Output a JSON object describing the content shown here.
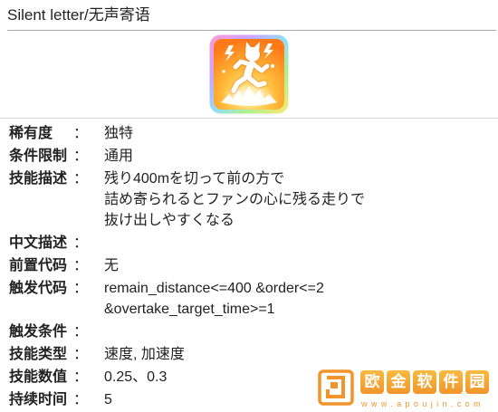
{
  "page": {
    "title": "Silent letter/无声寄语"
  },
  "skill_icon": {
    "icon": "running-figure-icon"
  },
  "separator": "：",
  "rows": [
    {
      "label": "稀有度",
      "lines": [
        "独特"
      ]
    },
    {
      "label": "条件限制",
      "lines": [
        "通用"
      ]
    },
    {
      "label": "技能描述",
      "lines": [
        "残り400mを切って前の方で",
        "詰め寄られるとファンの心に残る走りで",
        "抜け出しやすくなる"
      ]
    },
    {
      "label": "中文描述",
      "lines": []
    },
    {
      "label": "前置代码",
      "lines": [
        "无"
      ]
    },
    {
      "label": "触发代码",
      "lines": [
        "remain_distance<=400 &order<=2",
        "&overtake_target_time>=1"
      ]
    },
    {
      "label": "触发条件",
      "lines": []
    },
    {
      "label": "技能类型",
      "lines": [
        "速度, 加速度"
      ]
    },
    {
      "label": "技能数值",
      "lines": [
        "0.25、0.3"
      ]
    },
    {
      "label": "持续时间",
      "lines": [
        "5"
      ]
    }
  ],
  "watermark": {
    "logo_icon": "apoujin-logo-icon",
    "brand_chars": [
      "欧",
      "金",
      "软",
      "件",
      "园"
    ],
    "url": "www.apoujin.com"
  },
  "colors": {
    "text": "#222222",
    "title_rule": "#a2a9b1",
    "divider": "#d6d6d6",
    "background": "#ffffff",
    "icon_yellow": "#fff1a0",
    "icon_orange": "#ff7a16",
    "watermark_orange": "#f08c1a"
  }
}
